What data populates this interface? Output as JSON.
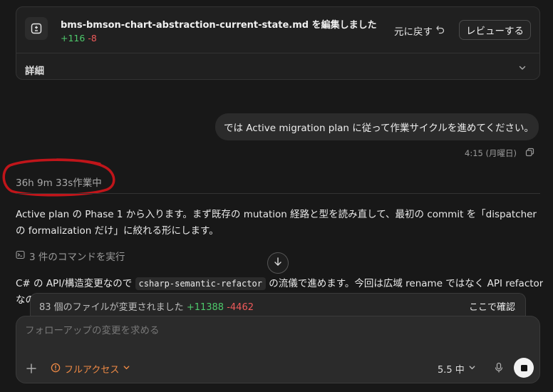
{
  "edit_card": {
    "file_name": "bms-bmson-chart-abstraction-current-state.md",
    "action_suffix": " を編集しました",
    "additions": "+116",
    "deletions": "-8",
    "undo_label": "元に戻す",
    "review_label": "レビューする",
    "details_label": "詳細"
  },
  "user_message": {
    "text": "では Active migration plan に従って作業サイクルを進めてください。",
    "timestamp": "4:15 (月曜日)"
  },
  "status": {
    "working_text": "36h 9m 33s作業中"
  },
  "assistant": {
    "paragraph1": "Active plan の Phase 1 から入ります。まず既存の mutation 経路と型を読み直して、最初の commit を「dispatcher の formalization だけ」に絞れる形にします。",
    "commands_label": "3 件のコマンドを実行",
    "p2_before": "C# の API/構造変更なので ",
    "p2_code": "csharp-semantic-refactor",
    "p2_after": " の流儀で進めます。今回は広域 rename ではなく API refactor",
    "p2_line2": "なの"
  },
  "files_bar": {
    "summary": "83 個のファイルが変更されました",
    "additions": "+11388",
    "deletions": "-4462",
    "confirm_label": "ここで確認"
  },
  "composer": {
    "placeholder": "フォローアップの変更を求める",
    "access_label": "フルアクセス",
    "model_label": "5.5 中"
  },
  "colors": {
    "background": "#181818",
    "addition": "#4ec96b",
    "deletion": "#ee5a5a",
    "access_accent": "#ef8a45",
    "annotation_red": "#c0151a"
  },
  "icons": [
    "file-diff-icon",
    "undo-icon",
    "chevron-down-icon",
    "copy-icon",
    "terminal-icon",
    "arrow-down-icon",
    "plus-icon",
    "alert-circle-icon",
    "mic-icon",
    "stop-icon"
  ]
}
